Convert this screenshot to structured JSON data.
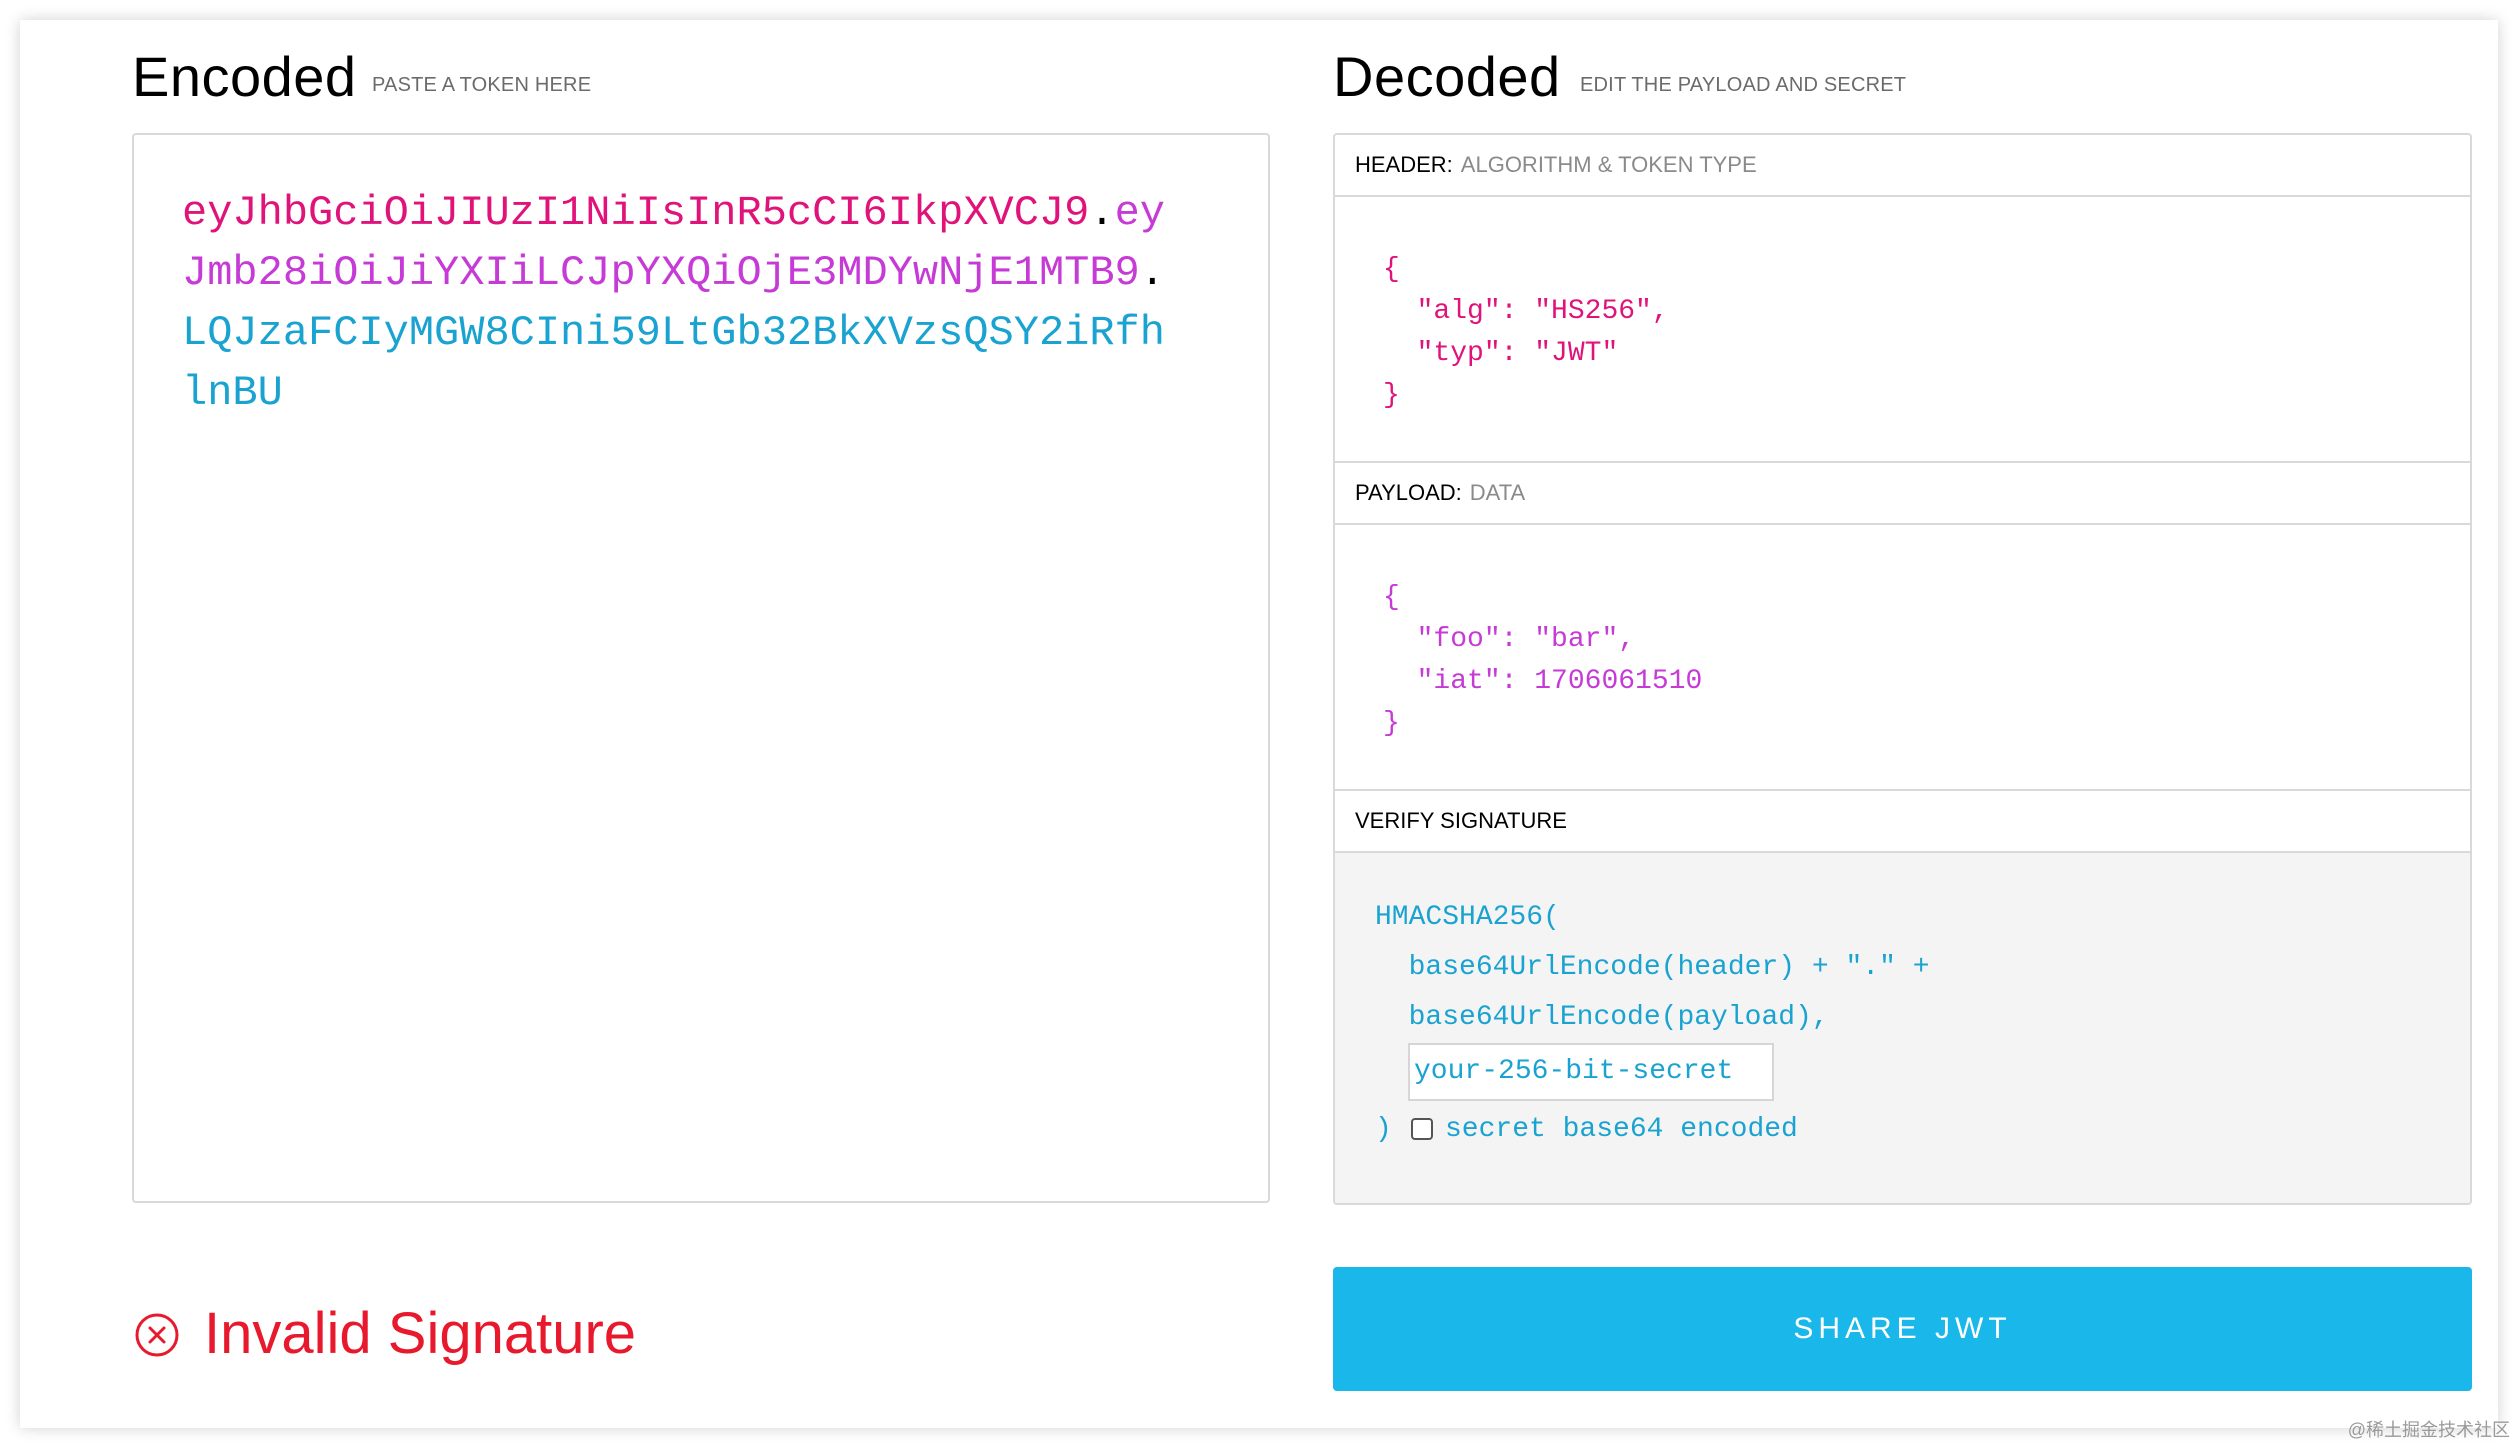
{
  "encoded": {
    "title": "Encoded",
    "subtitle": "PASTE A TOKEN HERE",
    "token_header": "eyJhbGciOiJIUzI1NiIsInR5cCI6IkpXVCJ9",
    "token_dot1": ".",
    "token_payload": "eyJmb28iOiJiYXIiLCJpYXQiOjE3MDYwNjE1MTB9",
    "token_dot2": ".",
    "token_signature": "LQJzaFCIyMGW8CIni59LtGb32BkXVzsQSY2iRfhlnBU"
  },
  "decoded": {
    "title": "Decoded",
    "subtitle": "EDIT THE PAYLOAD AND SECRET",
    "header_section": {
      "label": "HEADER:",
      "desc": "ALGORITHM & TOKEN TYPE"
    },
    "header_json": {
      "open": "{",
      "alg_key": "\"alg\"",
      "alg_val": "\"HS256\"",
      "typ_key": "\"typ\"",
      "typ_val": "\"JWT\"",
      "close": "}"
    },
    "payload_section": {
      "label": "PAYLOAD:",
      "desc": "DATA"
    },
    "payload_json": {
      "open": "{",
      "foo_key": "\"foo\"",
      "foo_val": "\"bar\"",
      "iat_key": "\"iat\"",
      "iat_val": "1706061510",
      "close": "}"
    },
    "verify_section": {
      "label": "VERIFY SIGNATURE"
    },
    "signature": {
      "fn": "HMACSHA256(",
      "line1": "base64UrlEncode(header) + \".\" +",
      "line2": "base64UrlEncode(payload),",
      "secret_value": "your-256-bit-secret",
      "close": ")",
      "checkbox_label": "secret base64 encoded",
      "checkbox_checked": false
    }
  },
  "status": {
    "text": "Invalid Signature",
    "icon": "circle-x-icon",
    "color": "#e8192c"
  },
  "share_button": {
    "label": "SHARE JWT",
    "color": "#1ab8ea"
  },
  "watermark": "@稀土掘金技术社区",
  "colors": {
    "header_part": "#e0137a",
    "payload_part": "#c63ad6",
    "signature_part": "#1aa3d1"
  }
}
